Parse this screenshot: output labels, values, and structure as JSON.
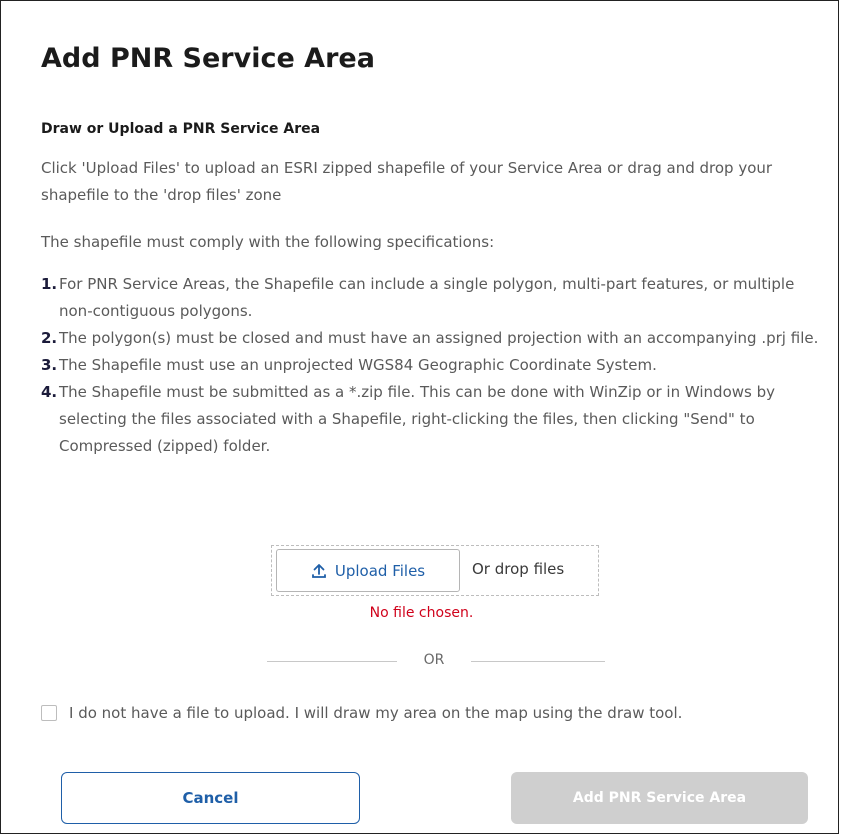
{
  "dialog": {
    "title": "Add PNR Service Area",
    "section_heading": "Draw or Upload a PNR Service Area",
    "intro": "Click 'Upload Files' to upload an ESRI zipped shapefile of your Service Area or drag and drop your shapefile to the 'drop files' zone",
    "spec_intro": "The shapefile must comply with the following specifications:",
    "specs": [
      {
        "num": "1.",
        "text": "For PNR Service Areas, the Shapefile can include a single polygon, multi-part features, or multiple non-contiguous polygons."
      },
      {
        "num": "2.",
        "text": "The polygon(s) must be closed and must have an assigned projection with an accompanying .prj file."
      },
      {
        "num": "3.",
        "text": "The Shapefile must use an unprojected WGS84 Geographic Coordinate System."
      },
      {
        "num": "4.",
        "text": "The Shapefile must be submitted as a *.zip file. This can be done with WinZip or in Windows by selecting the files associated with a Shapefile, right-clicking the files, then clicking \"Send\" to Compressed (zipped) folder."
      }
    ],
    "upload": {
      "button_label": "Upload Files",
      "button_icon": "upload-icon",
      "drop_label": "Or drop files",
      "status": "No file chosen."
    },
    "separator": "OR",
    "checkbox": {
      "label": "I do not have a file to upload. I will draw my area on the map using the draw tool.",
      "checked": false
    },
    "actions": {
      "cancel_label": "Cancel",
      "submit_label": "Add PNR Service Area"
    }
  },
  "colors": {
    "accent": "#1f5fa8",
    "error": "#d0021b",
    "disabled": "#cfcfcf",
    "text": "#5a5a5a",
    "heading": "#1b1b1b"
  }
}
